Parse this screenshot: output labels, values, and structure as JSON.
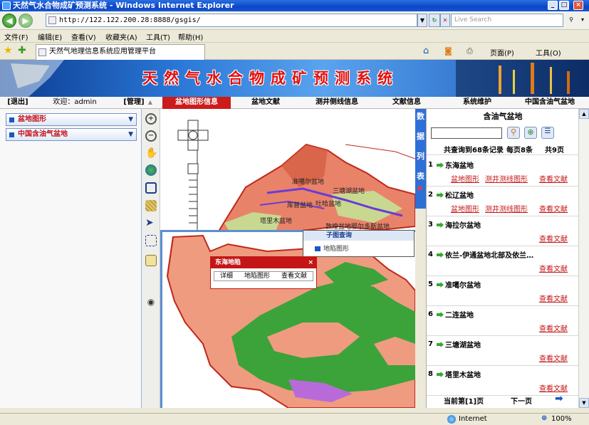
{
  "window": {
    "title": "天然气水合物成矿预测系统 - Windows Internet Explorer",
    "buttons": [
      "_",
      "□",
      "×"
    ]
  },
  "address": {
    "url": "http://122.122.200.28:8888/gsgis/",
    "search_placeholder": "Live Search"
  },
  "menu": [
    "文件(F)",
    "编辑(E)",
    "查看(V)",
    "收藏夹(A)",
    "工具(T)",
    "帮助(H)"
  ],
  "favbar": {
    "tab_title": "天然气地理信息系统应用管理平台",
    "page_label": "页面(P)",
    "tools_label": "工具(O)"
  },
  "banner": {
    "title": "天然气水合物成矿预测系统"
  },
  "nav": {
    "logout": "[退出]",
    "welcome": "欢迎：admin",
    "manage": "[管理]",
    "tabs": [
      "盆地图形信息",
      "盆地文献",
      "测井侧线信息",
      "文献信息",
      "系统维护",
      "中国含油气盆地"
    ]
  },
  "left": {
    "items": [
      "盆地图形",
      "中国含油气盆地"
    ]
  },
  "vtab": {
    "chars": [
      "数",
      "据",
      "列",
      "表"
    ]
  },
  "map": {
    "labels": [
      "准噶尔盆地",
      "三塘湖盆地",
      "吐哈盆地",
      "库普盆地",
      "塔里木盆地",
      "鄂尔多斯盆地",
      "敦煌盆地"
    ],
    "submenu": {
      "title": "子图查询",
      "item": "地陷图形"
    },
    "balloon": {
      "title": "东海地陷",
      "detail": "详细",
      "graph": "地陷图形",
      "docs": "查看文献"
    }
  },
  "results": {
    "title": "含油气盆地",
    "summary": {
      "total": "共查询到68条记录",
      "per_page": "每页8条",
      "pages": "共9页"
    },
    "items": [
      {
        "num": "1",
        "name": "东海盆地",
        "links": [
          "盆地图形",
          "测井测线图形",
          "查看文献"
        ]
      },
      {
        "num": "2",
        "name": "松辽盆地",
        "links": [
          "盆地图形",
          "测井测线图形",
          "查看文献"
        ]
      },
      {
        "num": "3",
        "name": "海拉尔盆地",
        "links": [
          "查看文献"
        ]
      },
      {
        "num": "4",
        "name": "依兰-伊通盆地北部及依兰…",
        "links": [
          "查看文献"
        ]
      },
      {
        "num": "5",
        "name": "准噶尔盆地",
        "links": [
          "查看文献"
        ]
      },
      {
        "num": "6",
        "name": "二连盆地",
        "links": [
          "查看文献"
        ]
      },
      {
        "num": "7",
        "name": "三塘湖盆地",
        "links": [
          "查看文献"
        ]
      },
      {
        "num": "8",
        "name": "塔里木盆地",
        "links": [
          "查看文献"
        ]
      }
    ],
    "pager": {
      "current": "当前第[1]页",
      "next": "下一页"
    }
  },
  "status": {
    "zone": "Internet",
    "zoom": "100%"
  }
}
